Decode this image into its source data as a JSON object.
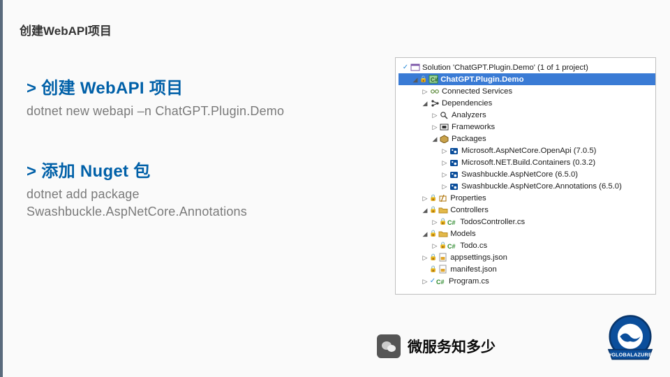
{
  "slide_title": "创建WebAPI项目",
  "section1": {
    "heading": "> 创建 WebAPI 项目",
    "command": "dotnet new webapi –n ChatGPT.Plugin.Demo"
  },
  "section2": {
    "heading": "> 添加 Nuget 包",
    "command": "dotnet add package Swashbuckle.AspNetCore.Annotations"
  },
  "solution": {
    "root": "Solution 'ChatGPT.Plugin.Demo' (1 of 1 project)",
    "project": "ChatGPT.Plugin.Demo",
    "nodes": {
      "connected_services": "Connected Services",
      "dependencies": "Dependencies",
      "analyzers": "Analyzers",
      "frameworks": "Frameworks",
      "packages": "Packages",
      "pkg1": "Microsoft.AspNetCore.OpenApi (7.0.5)",
      "pkg2": "Microsoft.NET.Build.Containers (0.3.2)",
      "pkg3": "Swashbuckle.AspNetCore (6.5.0)",
      "pkg4": "Swashbuckle.AspNetCore.Annotations (6.5.0)",
      "properties": "Properties",
      "controllers": "Controllers",
      "todos_controller": "TodosController.cs",
      "models": "Models",
      "todo": "Todo.cs",
      "appsettings": "appsettings.json",
      "manifest": "manifest.json",
      "program": "Program.cs"
    }
  },
  "footer": {
    "text": "微服务知多少"
  },
  "badge_text": "#GLOBALAZURE"
}
